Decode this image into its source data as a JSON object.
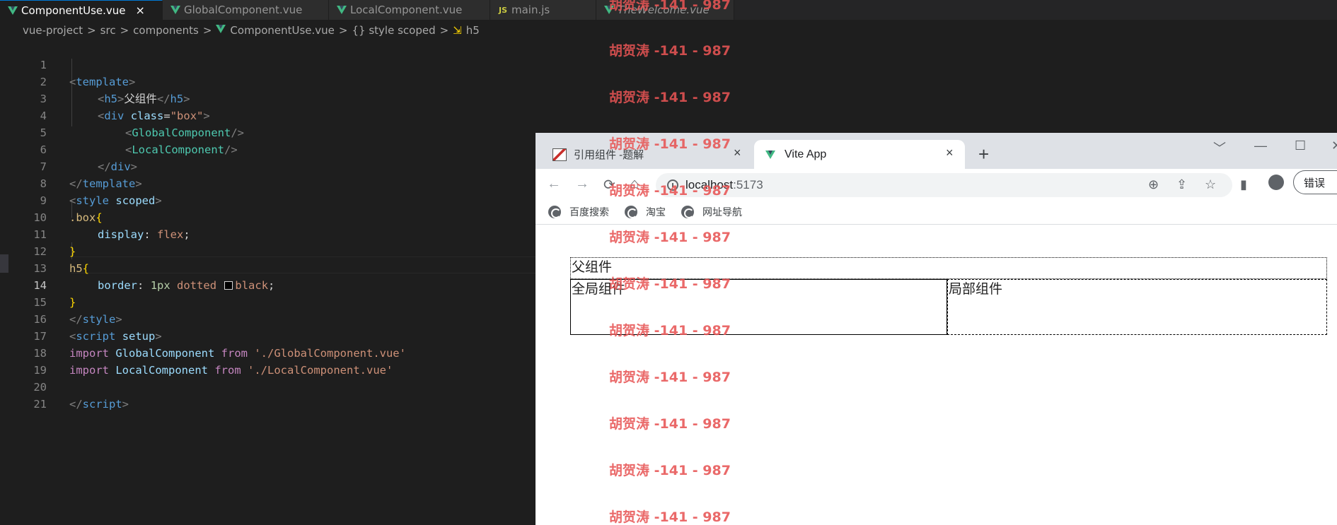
{
  "editor_tabs": [
    {
      "label": "ComponentUse.vue",
      "close": "×"
    },
    {
      "label": "GlobalComponent.vue"
    },
    {
      "label": "LocalComponent.vue"
    },
    {
      "label": "main.js",
      "icon_text": "JS"
    },
    {
      "label": "TheWelcome.vue"
    }
  ],
  "breadcrumb": {
    "parts": [
      "vue-project",
      "src",
      "components",
      "ComponentUse.vue",
      "{} style scoped",
      "h5"
    ],
    "separator": ">"
  },
  "line_numbers": [
    "1",
    "2",
    "3",
    "4",
    "5",
    "6",
    "7",
    "8",
    "9",
    "10",
    "11",
    "12",
    "13",
    "14",
    "15",
    "16",
    "17",
    "18",
    "19",
    "20",
    "21"
  ],
  "code": {
    "l1": {
      "open": "<",
      "tag": "template",
      "close": ">"
    },
    "l2": {
      "open": "<",
      "tag": "h5",
      "gt": ">",
      "text": "父组件",
      "endopen": "</",
      "endtag": "h5",
      "endclose": ">"
    },
    "l3": {
      "open": "<",
      "tag": "div",
      "attr": "class",
      "eq": "=",
      "val": "\"box\"",
      "close": ">"
    },
    "l4": {
      "open": "<",
      "tag": "GlobalComponent",
      "close": "/>"
    },
    "l5": {
      "open": "<",
      "tag": "LocalComponent",
      "close": "/>"
    },
    "l6": {
      "open": "</",
      "tag": "div",
      "close": ">"
    },
    "l7": {
      "open": "</",
      "tag": "template",
      "close": ">"
    },
    "l8": {
      "open": "<",
      "tag": "style",
      "attr": "scoped",
      "close": ">"
    },
    "l9": {
      "sel": ".box",
      "brace": "{"
    },
    "l10": {
      "prop": "display",
      "colon": ":",
      "val": "flex",
      "semi": ";"
    },
    "l11": {
      "brace": "}"
    },
    "l12": {
      "sel": "h5",
      "brace": "{"
    },
    "l13": {
      "prop": "border",
      "colon": ":",
      "num": "1px",
      "style": "dotted",
      "val": "black",
      "semi": ";"
    },
    "l14": {
      "brace": "}"
    },
    "l15": {
      "open": "</",
      "tag": "style",
      "close": ">"
    },
    "l16": {
      "open": "<",
      "tag": "script",
      "attr": "setup",
      "close": ">"
    },
    "l17": {
      "kw1": "import",
      "name": "GlobalComponent",
      "kw2": "from",
      "str": "'./GlobalComponent.vue'"
    },
    "l18": {
      "kw1": "import",
      "name": "LocalComponent",
      "kw2": "from",
      "str": "'./LocalComponent.vue'"
    },
    "l20": {
      "open": "</",
      "tag": "script",
      "close": ">"
    }
  },
  "browser": {
    "tabs": [
      {
        "title": "引用组件 -题解",
        "close": "×"
      },
      {
        "title": "Vite App",
        "close": "×"
      }
    ],
    "new_tab": "+",
    "window_controls": [
      "﹀",
      "—",
      "☐",
      "✕"
    ],
    "nav": {
      "back": "←",
      "forward": "→",
      "reload": "⟳",
      "home": "⌂"
    },
    "url_host": "localhost",
    "url_port": ":5173",
    "toolbar_icons": {
      "zoom": "⊕",
      "share": "⇪",
      "star": "☆",
      "sidebar": "▮"
    },
    "error_button": "错误",
    "bookmarks": [
      "百度搜索",
      "淘宝",
      "网址导航"
    ]
  },
  "page": {
    "heading": "父组件",
    "global_component": "全局组件",
    "local_component": "局部组件"
  },
  "watermark": {
    "text": "胡贺涛 -141 - 987",
    "color": "#e75454"
  }
}
